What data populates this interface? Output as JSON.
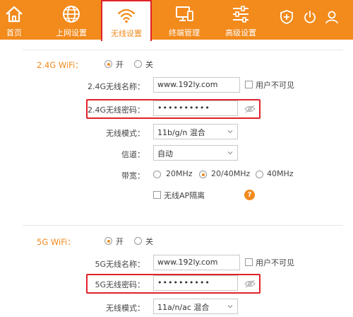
{
  "nav": {
    "items": [
      {
        "label": "首页",
        "icon": "home-icon"
      },
      {
        "label": "上网设置",
        "icon": "globe-icon"
      },
      {
        "label": "无线设置",
        "icon": "wifi-icon",
        "active": true
      },
      {
        "label": "终端管理",
        "icon": "monitor-icon"
      },
      {
        "label": "高级设置",
        "icon": "sliders-icon"
      }
    ],
    "right_icons": [
      "plus-shield-icon",
      "power-icon",
      "user-icon"
    ]
  },
  "colors": {
    "accent": "#f28a1c",
    "highlight": "#e0222a"
  },
  "wifi24": {
    "section_label": "2.4G WiFi：",
    "on_label": "开",
    "off_label": "关",
    "enabled": true,
    "name_label": "2.4G无线名称：",
    "name_value": "www.192ly.com",
    "hide_label": "用户不可见",
    "password_label": "2.4G无线密码：",
    "password_value": "••••••••••",
    "mode_label": "无线模式：",
    "mode_value": "11b/g/n 混合",
    "channel_label": "信道：",
    "channel_value": "自动",
    "bandwidth_label": "带宽：",
    "bw_20": "20MHz",
    "bw_2040": "20/40MHz",
    "bw_40": "40MHz",
    "bandwidth_selected": "20/40MHz",
    "ap_isolation_label": "无线AP隔离",
    "help": "?"
  },
  "wifi5": {
    "section_label": "5G WiFi：",
    "on_label": "开",
    "off_label": "关",
    "enabled": true,
    "name_label": "5G无线名称：",
    "name_value": "www.192ly.com",
    "hide_label": "用户不可见",
    "password_label": "5G无线密码：",
    "password_value": "••••••••••",
    "mode_label": "无线模式：",
    "mode_value": "11a/n/ac 混合"
  }
}
